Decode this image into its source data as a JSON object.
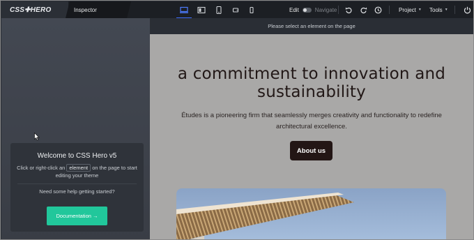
{
  "app": {
    "logo_text": "CSS✚HERO",
    "tab_label": "Inspector"
  },
  "toolbar": {
    "devices": [
      {
        "name": "desktop-wide-icon",
        "active": true
      },
      {
        "name": "desktop-icon",
        "active": false
      },
      {
        "name": "tablet-icon",
        "active": false
      },
      {
        "name": "tablet-landscape-icon",
        "active": false
      },
      {
        "name": "mobile-icon",
        "active": false
      }
    ],
    "edit_label": "Edit",
    "navigate_label": "Navigate",
    "project_label": "Project",
    "tools_label": "Tools"
  },
  "welcome": {
    "title": "Welcome to CSS Hero v5",
    "desc_before": "Click or right-click an",
    "element_word": "element",
    "desc_after": "on the page to start editing your theme",
    "help": "Need some help getting started?",
    "doc_button": "Documentation →"
  },
  "canvas": {
    "hint": "Please select an element on the page",
    "hero_title": "a commitment to innovation and sustainability",
    "hero_subtitle": "Études is a pioneering firm that seamlessly merges creativity and functionality to redefine architectural excellence.",
    "cta_label": "About us"
  },
  "colors": {
    "accent": "#3b6cff",
    "doc_button": "#21c79b",
    "cta_bg": "#231615",
    "canvas_bg": "#a9a8a7"
  }
}
